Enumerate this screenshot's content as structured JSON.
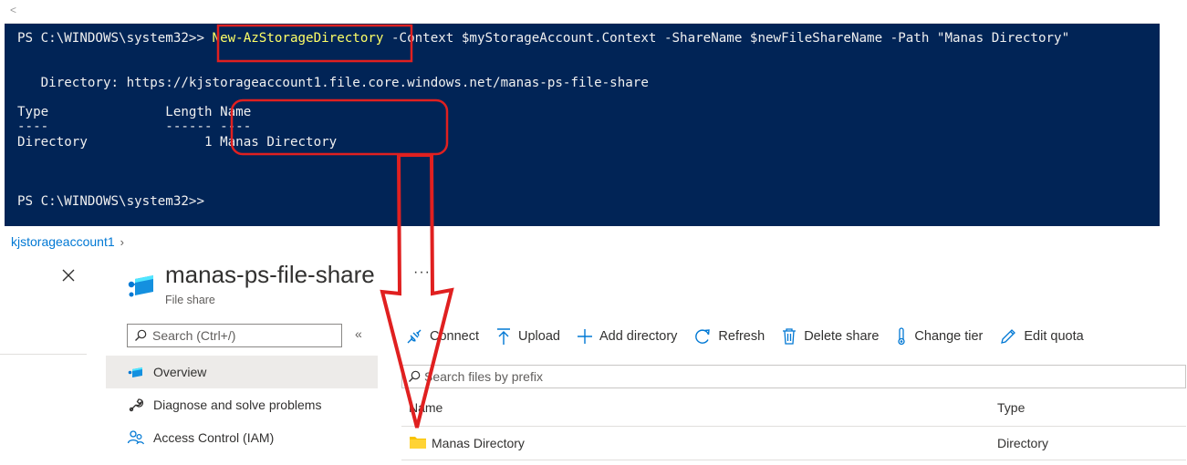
{
  "powershell": {
    "lines": {
      "prompt1": "PS C:\\WINDOWS\\system32>> ",
      "command": "New-AzStorageDirectory",
      "args": " -Context $myStorageAccount.Context -ShareName $newFileShareName -Path \"Manas Directory\"",
      "directory": "   Directory: https://kjstorageaccount1.file.core.windows.net/manas-ps-file-share",
      "header": "Type               Length Name",
      "underline": "----               ------ ----",
      "row": "Directory               1 Manas Directory",
      "prompt2": "PS C:\\WINDOWS\\system32>>"
    }
  },
  "portal": {
    "breadcrumb": "kjstorageaccount1",
    "blade": {
      "title": "manas-ps-file-share",
      "subtitle": "File share",
      "more": "···"
    },
    "menu": {
      "search_placeholder": "Search (Ctrl+/)",
      "collapse": "«",
      "items": [
        {
          "label": "Overview",
          "icon": "file-share-icon",
          "selected": true
        },
        {
          "label": "Diagnose and solve problems",
          "icon": "wrench-icon",
          "selected": false
        },
        {
          "label": "Access Control (IAM)",
          "icon": "people-icon",
          "selected": false
        }
      ]
    },
    "toolbar": {
      "connect": "Connect",
      "upload": "Upload",
      "add_directory": "Add directory",
      "refresh": "Refresh",
      "delete_share": "Delete share",
      "change_tier": "Change tier",
      "edit_quota": "Edit quota"
    },
    "files": {
      "search_placeholder": "Search files by prefix",
      "columns": {
        "name": "Name",
        "type": "Type"
      },
      "rows": [
        {
          "name": "Manas Directory",
          "type": "Directory",
          "icon": "folder-icon"
        }
      ]
    }
  },
  "colors": {
    "console_bg": "#012456",
    "annotation_red": "#e02020",
    "azure_blue": "#0078d4",
    "folder_yellow": "#f8c300"
  }
}
